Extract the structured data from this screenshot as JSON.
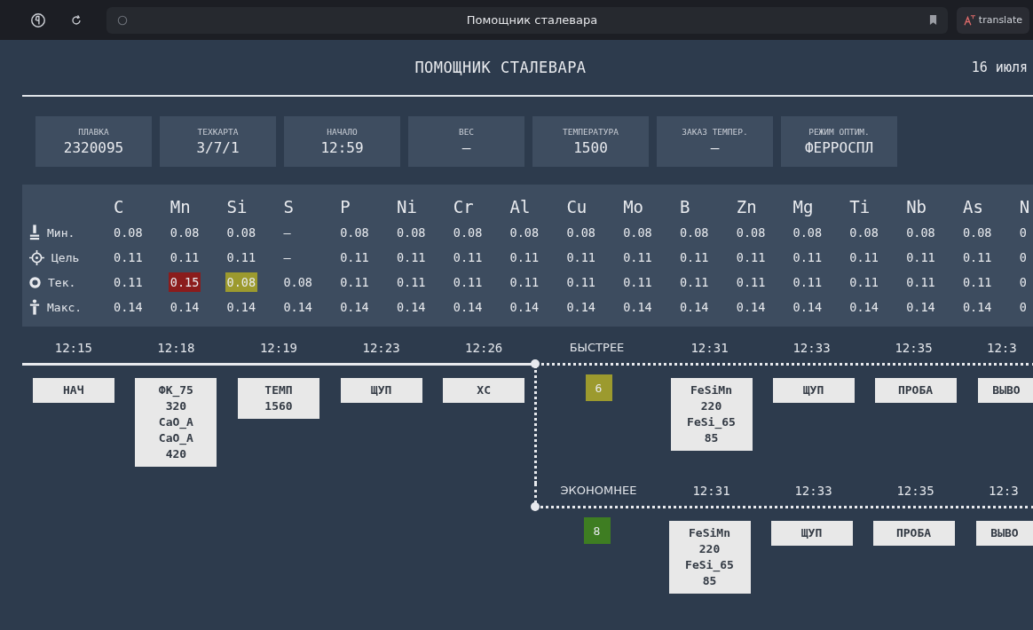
{
  "browser": {
    "title": "Помощник сталевара",
    "translate_label": "translate"
  },
  "header": {
    "title": "ПОМОЩНИК СТАЛЕВАРА",
    "date": "16 июля"
  },
  "info_cards": [
    {
      "label": "ПЛАВКА",
      "value": "2320095"
    },
    {
      "label": "ТЕХКАРТА",
      "value": "3/7/1"
    },
    {
      "label": "НАЧАЛО",
      "value": "12:59"
    },
    {
      "label": "ВЕС",
      "value": "—"
    },
    {
      "label": "ТЕМПЕРАТУРА",
      "value": "1500"
    },
    {
      "label": "ЗАКАЗ ТЕМПЕР.",
      "value": "—"
    },
    {
      "label": "РЕЖИМ ОПТИМ.",
      "value": "ФЕРРОСПЛ"
    }
  ],
  "composition": {
    "elements": [
      "C",
      "Mn",
      "Si",
      "S",
      "P",
      "Ni",
      "Cr",
      "Al",
      "Cu",
      "Mo",
      "B",
      "Zn",
      "Mg",
      "Ti",
      "Nb",
      "As",
      "N"
    ],
    "rows": [
      {
        "kind": "min",
        "label": "Мин.",
        "cells": [
          {
            "text": "0.08"
          },
          {
            "text": "0.08"
          },
          {
            "text": "0.08"
          },
          {
            "text": "—"
          },
          {
            "text": "0.08"
          },
          {
            "text": "0.08"
          },
          {
            "text": "0.08"
          },
          {
            "text": "0.08"
          },
          {
            "text": "0.08"
          },
          {
            "text": "0.08"
          },
          {
            "text": "0.08"
          },
          {
            "text": "0.08"
          },
          {
            "text": "0.08"
          },
          {
            "text": "0.08"
          },
          {
            "text": "0.08"
          },
          {
            "text": "0.08"
          },
          {
            "text": "0"
          }
        ]
      },
      {
        "kind": "target",
        "label": "Цель",
        "cells": [
          {
            "text": "0.11"
          },
          {
            "text": "0.11"
          },
          {
            "text": "0.11"
          },
          {
            "text": "—"
          },
          {
            "text": "0.11"
          },
          {
            "text": "0.11"
          },
          {
            "text": "0.11"
          },
          {
            "text": "0.11"
          },
          {
            "text": "0.11"
          },
          {
            "text": "0.11"
          },
          {
            "text": "0.11"
          },
          {
            "text": "0.11"
          },
          {
            "text": "0.11"
          },
          {
            "text": "0.11"
          },
          {
            "text": "0.11"
          },
          {
            "text": "0.11"
          },
          {
            "text": "0"
          }
        ]
      },
      {
        "kind": "current",
        "label": "Тек.",
        "cells": [
          {
            "text": "0.11"
          },
          {
            "text": "0.15",
            "color": "#8b1c1c"
          },
          {
            "text": "0.08",
            "color": "#9c9a2e"
          },
          {
            "text": "0.08"
          },
          {
            "text": "0.11"
          },
          {
            "text": "0.11"
          },
          {
            "text": "0.11"
          },
          {
            "text": "0.11"
          },
          {
            "text": "0.11"
          },
          {
            "text": "0.11"
          },
          {
            "text": "0.11"
          },
          {
            "text": "0.11"
          },
          {
            "text": "0.11"
          },
          {
            "text": "0.11"
          },
          {
            "text": "0.11"
          },
          {
            "text": "0.11"
          },
          {
            "text": "0"
          }
        ]
      },
      {
        "kind": "max",
        "label": "Макс.",
        "cells": [
          {
            "text": "0.14"
          },
          {
            "text": "0.14"
          },
          {
            "text": "0.14"
          },
          {
            "text": "0.14"
          },
          {
            "text": "0.14"
          },
          {
            "text": "0.14"
          },
          {
            "text": "0.14"
          },
          {
            "text": "0.14"
          },
          {
            "text": "0.14"
          },
          {
            "text": "0.14"
          },
          {
            "text": "0.14"
          },
          {
            "text": "0.14"
          },
          {
            "text": "0.14"
          },
          {
            "text": "0.14"
          },
          {
            "text": "0.14"
          },
          {
            "text": "0.14"
          },
          {
            "text": "0"
          }
        ]
      }
    ]
  },
  "timeline": {
    "main": [
      {
        "time": "12:15",
        "lines": [
          "НАЧ"
        ]
      },
      {
        "time": "12:18",
        "lines": [
          "ФК_75",
          "320",
          "CaO_A",
          "CaO_A",
          "420"
        ]
      },
      {
        "time": "12:19",
        "lines": [
          "ТЕМП",
          "1560"
        ]
      },
      {
        "time": "12:23",
        "lines": [
          "ЩУП"
        ]
      },
      {
        "time": "12:26",
        "lines": [
          "ХС"
        ]
      }
    ],
    "branches": [
      {
        "label": "БЫСТРЕЕ",
        "badge": "6",
        "color": "#9c9a2e",
        "steps": [
          {
            "time": "12:31",
            "lines": [
              "FeSiMn",
              "220",
              "FeSi_65",
              "85"
            ]
          },
          {
            "time": "12:33",
            "lines": [
              "ЩУП"
            ]
          },
          {
            "time": "12:35",
            "lines": [
              "ПРОБА"
            ]
          },
          {
            "time": "12:3",
            "lines": [
              "ВЫВО"
            ]
          }
        ]
      },
      {
        "label": "ЭКОНОМНЕЕ",
        "badge": "8",
        "color": "#3e7d22",
        "steps": [
          {
            "time": "12:31",
            "lines": [
              "FeSiMn",
              "220",
              "FeSi_65",
              "85"
            ]
          },
          {
            "time": "12:33",
            "lines": [
              "ЩУП"
            ]
          },
          {
            "time": "12:35",
            "lines": [
              "ПРОБА"
            ]
          },
          {
            "time": "12:3",
            "lines": [
              "ВЫВО"
            ]
          }
        ]
      }
    ]
  }
}
